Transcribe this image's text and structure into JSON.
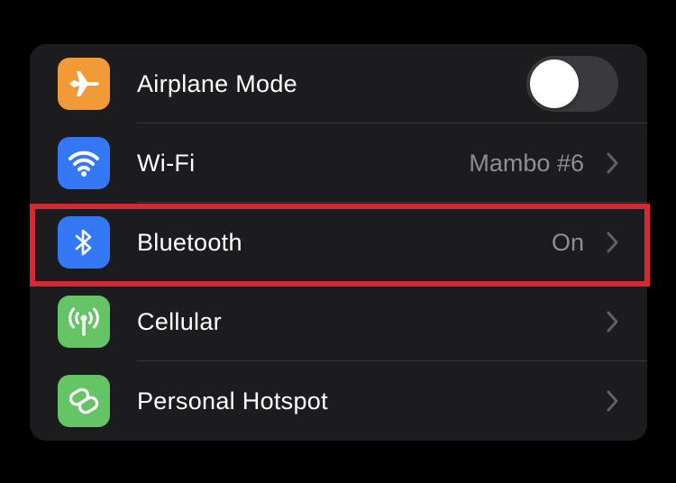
{
  "colors": {
    "background": "#000000",
    "card": "#1c1c1e",
    "airplane_tile": "#f19a37",
    "wifi_tile": "#3478f6",
    "bluetooth_tile": "#3478f6",
    "cellular_tile": "#65c466",
    "hotspot_tile": "#65c466",
    "highlight": "#d52a33",
    "secondary_text": "#8e8e93"
  },
  "settings": {
    "items": [
      {
        "label": "Airplane Mode",
        "icon": "airplane-icon",
        "control": "toggle",
        "toggle_on": false
      },
      {
        "label": "Wi-Fi",
        "icon": "wifi-icon",
        "value": "Mambo #6",
        "control": "chevron"
      },
      {
        "label": "Bluetooth",
        "icon": "bluetooth-icon",
        "value": "On",
        "control": "chevron",
        "highlighted": true
      },
      {
        "label": "Cellular",
        "icon": "cellular-antenna-icon",
        "value": "",
        "control": "chevron"
      },
      {
        "label": "Personal Hotspot",
        "icon": "hotspot-link-icon",
        "value": "",
        "control": "chevron"
      }
    ]
  }
}
